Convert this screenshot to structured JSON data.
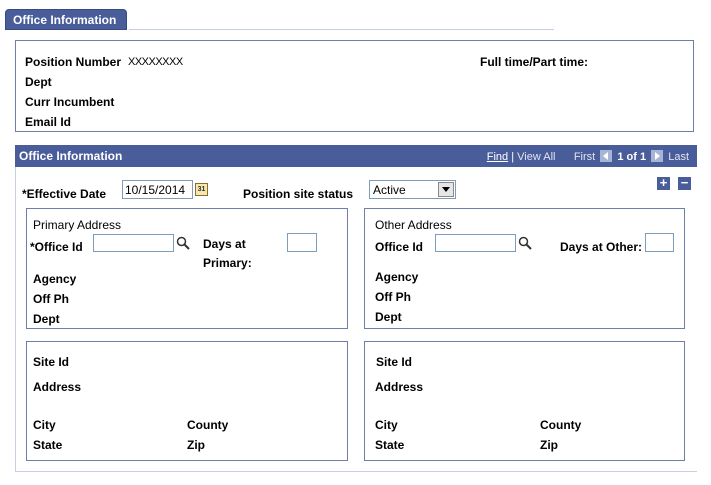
{
  "tab": {
    "label": "Office Information"
  },
  "header_box": {
    "position_number_label": "Position Number",
    "position_number_value": "XXXXXXXX",
    "dept_label": "Dept",
    "curr_incumbent_label": "Curr Incumbent",
    "email_label": "Email Id",
    "full_part_label": "Full time/Part time:"
  },
  "grid": {
    "title": "Office Information",
    "find": "Find",
    "separator": "|",
    "view_all": "View All",
    "first": "First",
    "count": "1 of 1",
    "last": "Last",
    "add_label": "+",
    "remove_label": "−"
  },
  "form": {
    "effective_date_label": "*Effective Date",
    "effective_date_value": "10/15/2014",
    "position_site_status_label": "Position site status",
    "position_site_status_value": "Active",
    "calendar_glyph": "31"
  },
  "primary": {
    "title": "Primary Address",
    "office_id_label": "*Office Id",
    "office_id_value": "",
    "days_label_1": "Days at",
    "days_label_2": "Primary:",
    "days_value": "",
    "agency_label": "Agency",
    "off_ph_label": "Off Ph",
    "dept_label": "Dept"
  },
  "other": {
    "title": "Other Address",
    "office_id_label": "Office Id",
    "office_id_value": "",
    "days_label": "Days at Other:",
    "days_value": "",
    "agency_label": "Agency",
    "off_ph_label": "Off Ph",
    "dept_label": "Dept"
  },
  "site_left": {
    "site_id_label": "Site Id",
    "address_label": "Address",
    "city_label": "City",
    "county_label": "County",
    "state_label": "State",
    "zip_label": "Zip"
  },
  "site_right": {
    "site_id_label": "Site Id",
    "address_label": "Address",
    "city_label": "City",
    "county_label": "County",
    "state_label": "State",
    "zip_label": "Zip"
  },
  "colors": {
    "header_blue": "#4a5d9b",
    "border_blue": "#6d7fa8"
  },
  "icons": [
    "calendar-icon",
    "lookup-icon",
    "prev-icon",
    "next-icon",
    "add-row-icon",
    "remove-row-icon"
  ]
}
